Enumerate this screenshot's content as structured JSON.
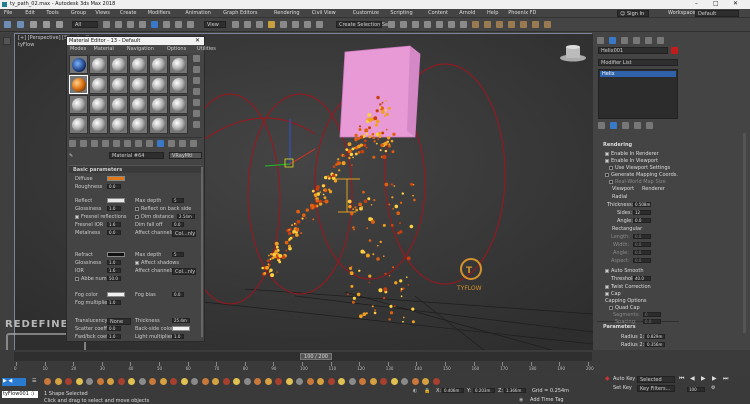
{
  "window": {
    "title": "ty_path_02.max - Autodesk 3ds Max 2018",
    "sign_in": "Sign In",
    "workspaces_label": "Workspaces:",
    "workspace": "Default"
  },
  "menu": [
    "File",
    "Edit",
    "Tools",
    "Group",
    "Views",
    "Create",
    "Modifiers",
    "Animation",
    "Graph Editors",
    "Rendering",
    "Civil View",
    "Customize",
    "Scripting",
    "Content",
    "Arnold",
    "Help",
    "Phoenix FD"
  ],
  "toolbar": {
    "filter": "All",
    "view": "View",
    "selection_set": "Create Selection Se"
  },
  "viewport": {
    "label": "[+] [Perspective] [Standard]",
    "tyflow_label": "tyFlow",
    "watermark": "REDEFINEFX.COM",
    "logo_text": "TYFLOW"
  },
  "material_editor": {
    "title": "Material Editor - 13 - Default",
    "menu": [
      "Modes",
      "Material",
      "Navigation",
      "Options",
      "Utilities"
    ],
    "material_name": "Material #64",
    "material_type": "VRayMtl",
    "section": "Basic parameters",
    "labels": {
      "diffuse": "Diffuse",
      "roughness": "Roughness",
      "reflect": "Reflect",
      "glossiness": "Glossiness",
      "fresnel": "Fresnel reflections",
      "fresnel_ior": "Fresnel IOR",
      "metalness": "Metalness",
      "max_depth": "Max depth",
      "reflect_back": "Reflect on back side",
      "dim_distance": "Dim distance",
      "dim_falloff": "Dim fall off",
      "affect_channels": "Affect channels",
      "refract": "Refract",
      "ior": "IOR",
      "abbe": "Abbe number",
      "affect_shadows": "Affect shadows",
      "fog_color": "Fog color",
      "fog_multiplier": "Fog multiplier",
      "fog_bias": "Fog bias",
      "translucency": "Translucency",
      "thickness": "Thickness",
      "back_side_color": "Back-side color",
      "light_multiplier": "Light multiplier",
      "scatter_coeff": "Scatter coeff",
      "fwd_bck_coeff": "Fwd/bck coeff",
      "color_only": "Col...nly"
    },
    "values": {
      "roughness": "0.0",
      "glossiness": "1.0",
      "fresnel_ior": "1.6",
      "metalness": "0.0",
      "max_depth": "5",
      "dim_distance": "2.54m",
      "dim_falloff": "0.0",
      "glossiness2": "1.0",
      "ior": "1.6",
      "abbe": "50.0",
      "max_depth2": "5",
      "fog_multiplier": "1.0",
      "fog_bias": "0.0",
      "translucency": "None",
      "thickness": "25.4m",
      "light_multiplier": "1.0",
      "scatter": "0.0",
      "fwd": "1.0"
    },
    "diffuse_color": "#e07818"
  },
  "right_panel": {
    "object_name": "Helix001",
    "modifier_list": "Modifier List",
    "stack_item": "Helix",
    "rendering": {
      "header": "Rendering",
      "enable_renderer": "Enable In Renderer",
      "enable_viewport": "Enable In Viewport",
      "use_viewport": "Use Viewport Settings",
      "gen_mapping": "Generate Mapping Coords.",
      "real_world": "Real-World Map Size",
      "viewport": "Viewport",
      "renderer": "Renderer",
      "radial": "Radial",
      "thickness": "Thickness:",
      "thickness_val": "0.508m",
      "sides": "Sides:",
      "sides_val": "12",
      "angle": "Angle:",
      "angle_val": "0.0",
      "rectangular": "Rectangular",
      "length": "Length:",
      "length_val": "0.0",
      "width": "Width:",
      "width_val": "0.0",
      "angle2": "Angle:",
      "angle2_val": "0.0",
      "aspect": "Aspect:",
      "aspect_val": "0.0",
      "auto_smooth": "Auto Smooth",
      "threshold": "Threshold:",
      "threshold_val": "40.0",
      "twist": "Twist Correction",
      "cap": "Cap",
      "capping": "Capping Options",
      "quad_cap": "Quad Cap",
      "segments": "Segments:",
      "segments_val": "0",
      "spacing": "Spacing:",
      "spacing_val": "0.0"
    },
    "parameters": {
      "header": "Parameters",
      "radius1": "Radius 1:",
      "radius1_val": "0.829m",
      "radius2": "Radius 2:",
      "radius2_val": "0.356m"
    }
  },
  "timeline": {
    "frame": "100 / 200",
    "ticks": [
      "0",
      "10",
      "20",
      "30",
      "40",
      "50",
      "60",
      "70",
      "80",
      "90",
      "100",
      "110",
      "120",
      "130",
      "140",
      "150",
      "160",
      "170",
      "180",
      "190",
      "200"
    ]
  },
  "status": {
    "maxscript": "tyFlow001 :)",
    "selected": "1 Shape Selected",
    "prompt": "Click and drag to select and move objects",
    "x_label": "X:",
    "x": "0.406m",
    "y_label": "Y:",
    "y": "0.203m",
    "z_label": "Z:",
    "z": "1.366m",
    "grid": "Grid = 0.254m",
    "add_time_tag": "Add Time Tag",
    "auto_key": "Auto Key",
    "selected_dd": "Selected",
    "set_key": "Set Key",
    "key_filters": "Key Filters...",
    "frame_field": "100"
  }
}
